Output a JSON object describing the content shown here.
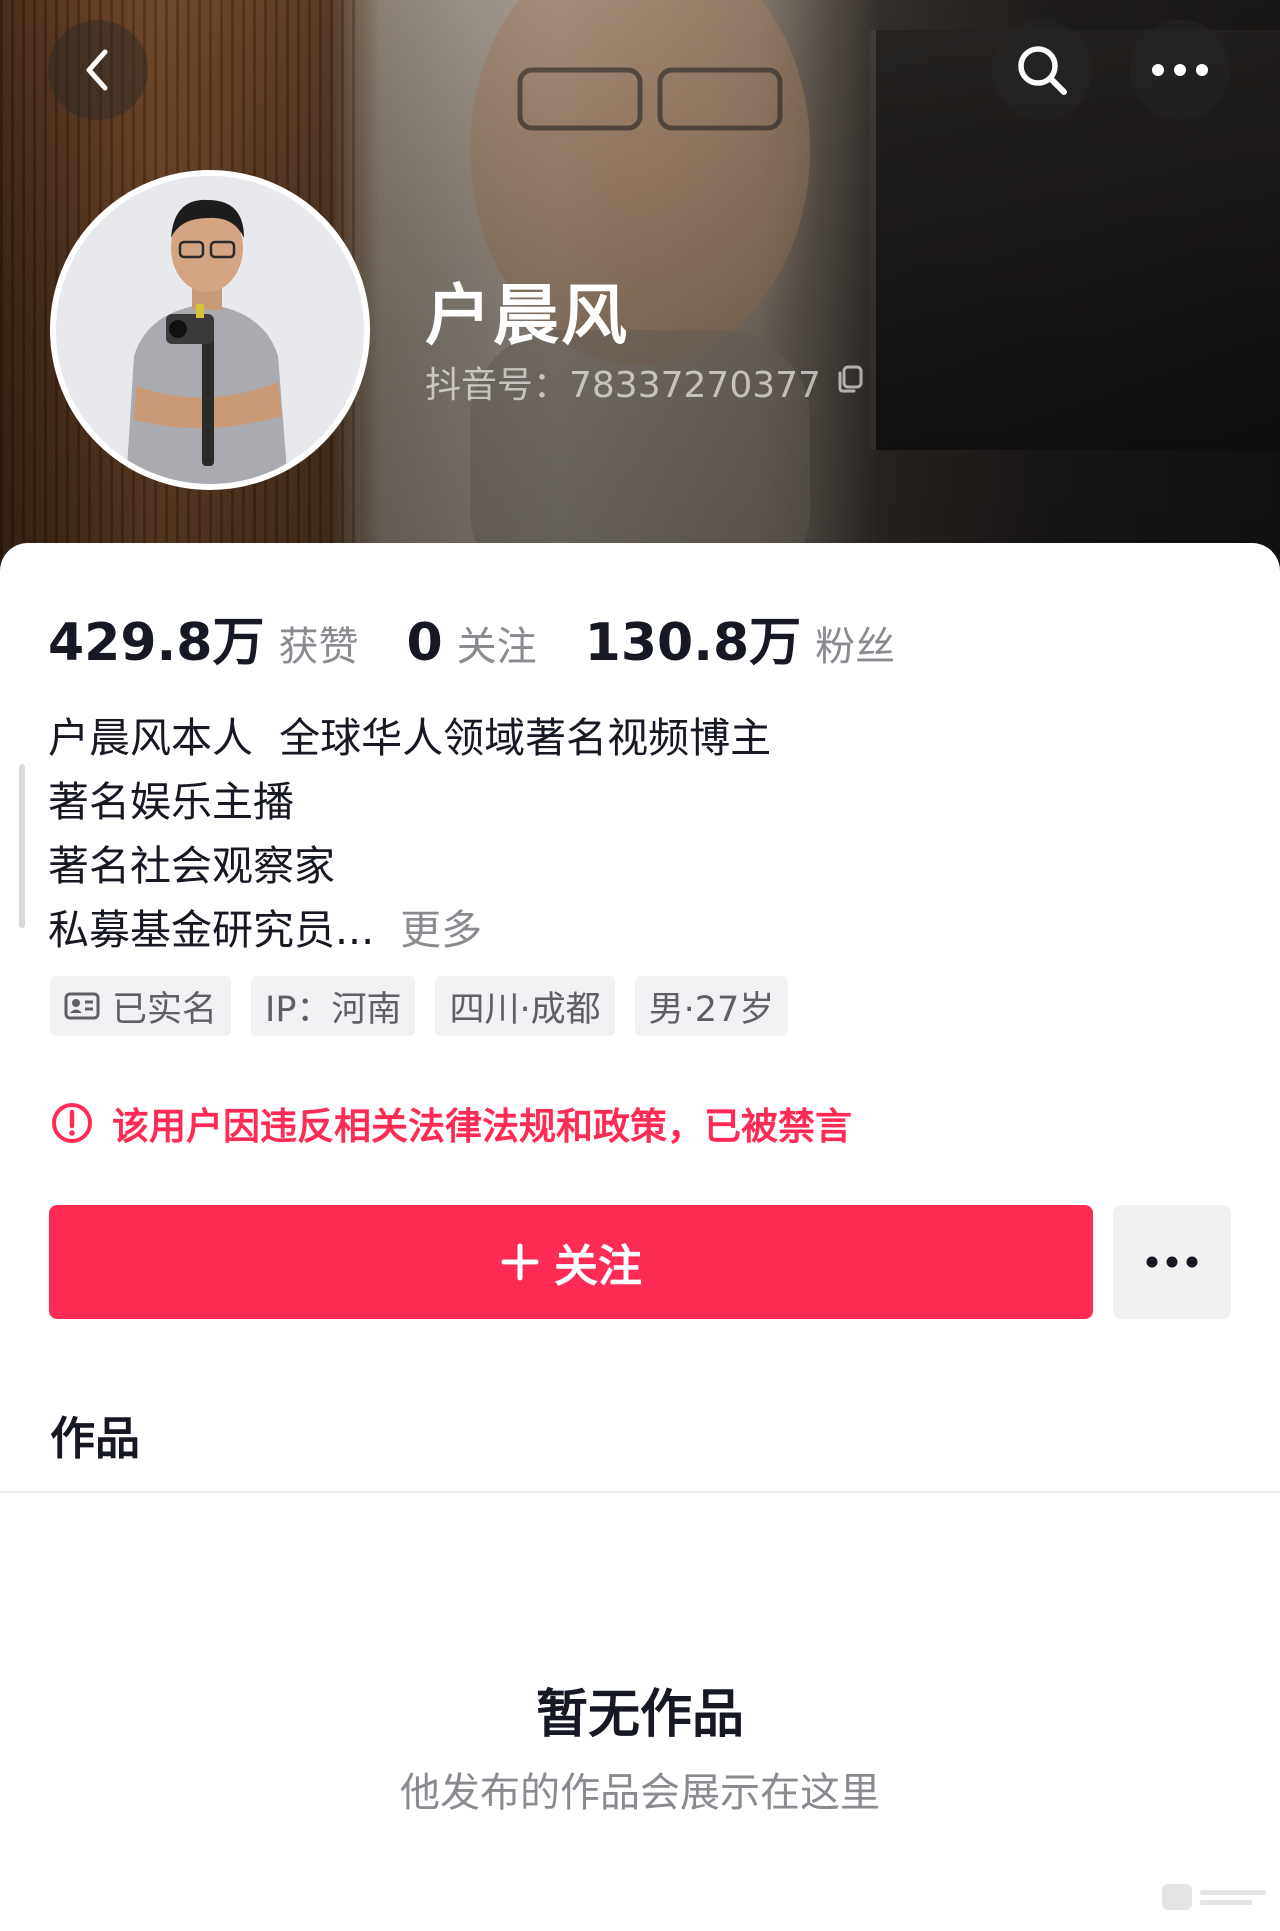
{
  "header": {
    "back_icon": "chevron-left-icon",
    "search_icon": "search-icon",
    "menu_icon": "more-horizontal-icon"
  },
  "profile": {
    "nickname": "户晨风",
    "account_id": "抖音号：78337270377",
    "copy_icon": "copy-icon"
  },
  "stats": [
    {
      "value": "429.8万",
      "label": "获赞"
    },
    {
      "value": "0",
      "label": "关注"
    },
    {
      "value": "130.8万",
      "label": "粉丝"
    }
  ],
  "bio": {
    "lines": [
      "户晨风本人  全球华人领域著名视频博主",
      "著名娱乐主播",
      "著名社会观察家",
      "私募基金研究员..."
    ],
    "more_label": "更多"
  },
  "tags": [
    {
      "label": "已实名",
      "icon": "id-card-icon"
    },
    {
      "label": "IP：河南"
    },
    {
      "label": "四川·成都"
    },
    {
      "label": "男·27岁"
    }
  ],
  "notice": {
    "text": "该用户因违反相关法律法规和政策，已被禁言",
    "icon": "warning-circle-icon"
  },
  "actions": {
    "follow_label": "关注",
    "follow_icon": "plus-icon",
    "more_icon": "more-horizontal-icon"
  },
  "works_tab": {
    "label": "作品"
  },
  "empty_state": {
    "title": "暂无作品",
    "subtitle": "他发布的作品会展示在这里"
  },
  "colors": {
    "accent": "#fe2c55",
    "text_primary": "#161823",
    "text_secondary": "#8a8b91",
    "tag_bg": "#f2f2f4"
  }
}
